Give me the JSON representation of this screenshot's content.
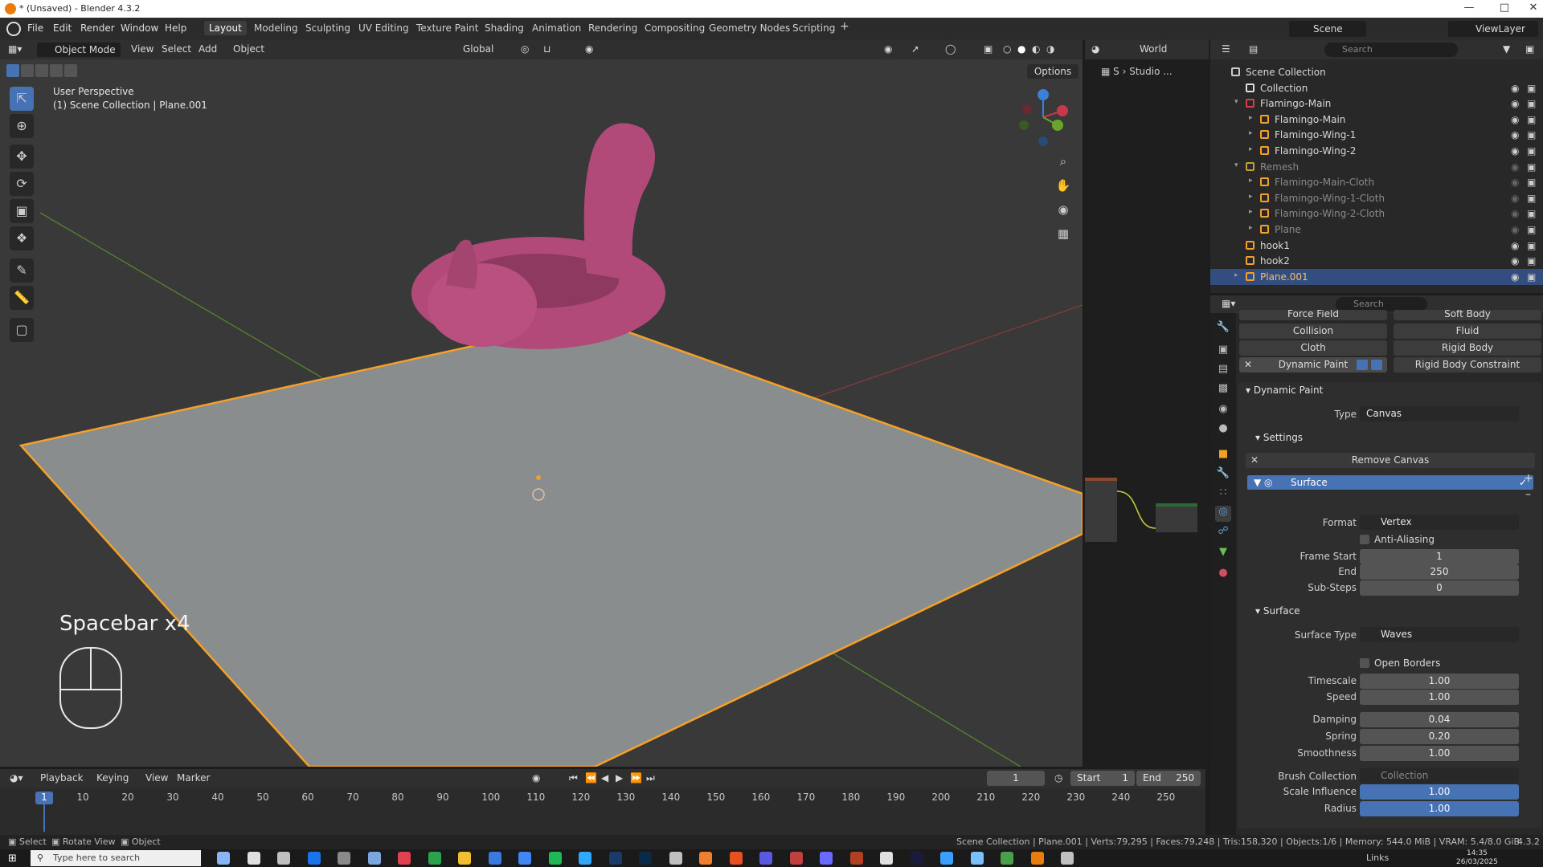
{
  "window": {
    "title": "* (Unsaved) - Blender 4.3.2"
  },
  "menus": [
    "File",
    "Edit",
    "Render",
    "Window",
    "Help"
  ],
  "workspaces": [
    "Layout",
    "Modeling",
    "Sculpting",
    "UV Editing",
    "Texture Paint",
    "Shading",
    "Animation",
    "Rendering",
    "Compositing",
    "Geometry Nodes",
    "Scripting"
  ],
  "topright": {
    "scene": "Scene",
    "viewlayer": "ViewLayer"
  },
  "viewport": {
    "mode": "Object Mode",
    "menu": [
      "View",
      "Select",
      "Add",
      "Object"
    ],
    "orientation": "Global",
    "options": "Options",
    "perspective": "User Perspective",
    "context": "(1) Scene Collection | Plane.001",
    "overlay_text": "Spacebar x4",
    "render_menu": "World",
    "studio": "Studio ..."
  },
  "outliner": {
    "search_placeholder": "Search",
    "rows": [
      {
        "label": "Scene Collection",
        "indent": 0,
        "icon": "scene-collection-icon",
        "dim": false,
        "sel": false
      },
      {
        "label": "Collection",
        "indent": 1,
        "icon": "collection-icon",
        "dim": false,
        "sel": false
      },
      {
        "label": "Flamingo-Main",
        "indent": 1,
        "icon": "collection-red-icon",
        "dim": false,
        "sel": false
      },
      {
        "label": "Flamingo-Main",
        "indent": 2,
        "icon": "mesh-icon",
        "dim": false,
        "sel": false
      },
      {
        "label": "Flamingo-Wing-1",
        "indent": 2,
        "icon": "mesh-icon",
        "dim": false,
        "sel": false
      },
      {
        "label": "Flamingo-Wing-2",
        "indent": 2,
        "icon": "mesh-icon",
        "dim": false,
        "sel": false
      },
      {
        "label": "Remesh",
        "indent": 1,
        "icon": "collection-yellow-icon",
        "dim": true,
        "sel": false
      },
      {
        "label": "Flamingo-Main-Cloth",
        "indent": 2,
        "icon": "mesh-icon",
        "dim": true,
        "sel": false
      },
      {
        "label": "Flamingo-Wing-1-Cloth",
        "indent": 2,
        "icon": "mesh-icon",
        "dim": true,
        "sel": false
      },
      {
        "label": "Flamingo-Wing-2-Cloth",
        "indent": 2,
        "icon": "mesh-icon",
        "dim": true,
        "sel": false
      },
      {
        "label": "Plane",
        "indent": 2,
        "icon": "mesh-icon",
        "dim": true,
        "sel": false
      },
      {
        "label": "hook1",
        "indent": 1,
        "icon": "armature-icon",
        "dim": false,
        "sel": false
      },
      {
        "label": "hook2",
        "indent": 1,
        "icon": "armature-icon",
        "dim": false,
        "sel": false
      },
      {
        "label": "Plane.001",
        "indent": 1,
        "icon": "mesh-icon",
        "dim": false,
        "sel": true
      }
    ]
  },
  "properties": {
    "search_placeholder": "Search",
    "physics": [
      "Force Field",
      "Soft Body",
      "Collision",
      "Fluid",
      "Cloth",
      "Rigid Body",
      "Dynamic Paint",
      "Rigid Body Constraint"
    ],
    "dp_header": "Dynamic Paint",
    "type_label": "Type",
    "type_value": "Canvas",
    "settings_header": "Settings",
    "remove_canvas": "Remove Canvas",
    "surface_item": "Surface",
    "format_label": "Format",
    "format_value": "Vertex",
    "anti_aliasing": "Anti-Aliasing",
    "frame_start_label": "Frame Start",
    "frame_start": "1",
    "end_label": "End",
    "end": "250",
    "substeps_label": "Sub-Steps",
    "substeps": "0",
    "surface_header": "Surface",
    "surface_type_label": "Surface Type",
    "surface_type": "Waves",
    "open_borders": "Open Borders",
    "timescale_label": "Timescale",
    "timescale": "1.00",
    "speed_label": "Speed",
    "speed": "1.00",
    "damping_label": "Damping",
    "damping": "0.04",
    "spring_label": "Spring",
    "spring": "0.20",
    "smoothness_label": "Smoothness",
    "smoothness": "1.00",
    "brush_collection_label": "Brush Collection",
    "brush_collection": "Collection",
    "scale_influence_label": "Scale Influence",
    "scale_influence": "1.00",
    "radius_label": "Radius",
    "radius": "1.00"
  },
  "timeline": {
    "menu": [
      "Playback",
      "Keying",
      "View",
      "Marker"
    ],
    "current_frame": "1",
    "start_label": "Start",
    "start": "1",
    "end_label": "End",
    "end": "250",
    "ticks": [
      "1",
      "10",
      "20",
      "30",
      "40",
      "50",
      "60",
      "70",
      "80",
      "90",
      "100",
      "110",
      "120",
      "130",
      "140",
      "150",
      "160",
      "170",
      "180",
      "190",
      "200",
      "210",
      "220",
      "230",
      "240",
      "250"
    ]
  },
  "status": {
    "left": [
      "Select",
      "Rotate View",
      "Object"
    ],
    "right": "Scene Collection | Plane.001 | Verts:79,295 | Faces:79,248 | Tris:158,320 | Objects:1/6 | Memory: 544.0 MiB | VRAM: 5.4/8.0 GiB",
    "version": "4.3.2"
  },
  "taskbar": {
    "search": "Type here to search",
    "links": "Links",
    "time": "14:35",
    "date": "26/03/2025"
  },
  "colors": {
    "accent": "#4772b3",
    "selection_orange": "#f5a029",
    "flamingo": "#b14a78"
  }
}
